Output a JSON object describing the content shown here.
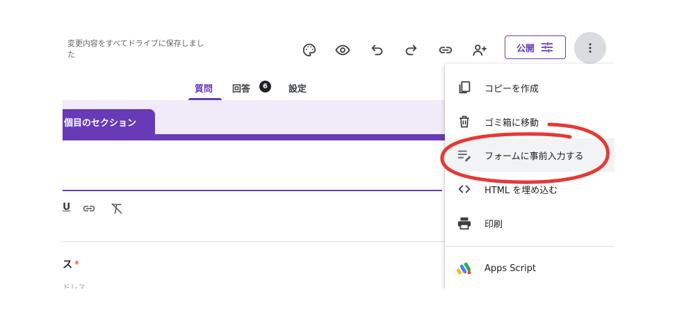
{
  "header": {
    "save_status": "変更内容をすべてドライブに保存しました",
    "publish_label": "公開"
  },
  "tabs": [
    {
      "label": "質問",
      "active": true
    },
    {
      "label": "回答",
      "badge": "6"
    },
    {
      "label": "設定"
    }
  ],
  "form": {
    "section_label": "個目のセクション",
    "format_fragment": "U",
    "question_fragment": "ス",
    "required_mark": "*",
    "question_sub_fragment": "ドレス"
  },
  "menu": {
    "items": [
      {
        "label": "コピーを作成",
        "icon": "copy-icon"
      },
      {
        "label": "ゴミ箱に移動",
        "icon": "trash-icon"
      },
      {
        "label": "フォームに事前入力する",
        "icon": "prefill-icon",
        "highlighted": true
      },
      {
        "label": "HTML を埋め込む",
        "icon": "code-icon"
      },
      {
        "label": "印刷",
        "icon": "print-icon"
      },
      {
        "label": "Apps Script",
        "icon": "apps-script-icon"
      }
    ]
  },
  "colors": {
    "accent": "#673ab7",
    "annotation": "#e53935",
    "canvas": "#f0ebf8"
  }
}
